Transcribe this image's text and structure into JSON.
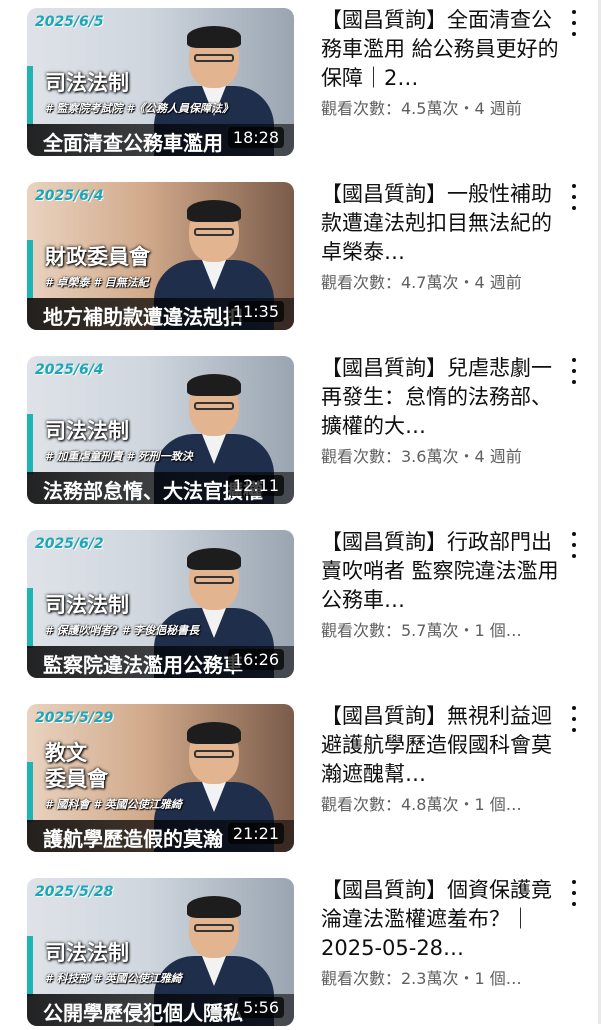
{
  "videos": [
    {
      "date": "2025/6/5",
      "committee": "司法法制",
      "tags": "# 監察院考試院  #《公務人員保障法》",
      "headline": "全面清查公務車濫用",
      "duration": "18:28",
      "title": "【國昌質詢】全面清查公務車濫用 給公務員更好的保障｜2…",
      "meta": "觀看次數：4.5萬次・4 週前"
    },
    {
      "date": "2025/6/4",
      "committee": "財政委員會",
      "tags": "# 卓榮泰  # 目無法紀",
      "headline": "地方補助款遭違法剋扣",
      "duration": "11:35",
      "title": "【國昌質詢】一般性補助款遭違法剋扣目無法紀的卓榮泰…",
      "meta": "觀看次數：4.7萬次・4 週前"
    },
    {
      "date": "2025/6/4",
      "committee": "司法法制",
      "tags": "# 加重虐童刑責  # 死刑一致決",
      "headline": "法務部怠惰、大法官擴權",
      "duration": "12:11",
      "title": "【國昌質詢】兒虐悲劇一再發生：怠惰的法務部、擴權的大…",
      "meta": "觀看次數：3.6萬次・4 週前"
    },
    {
      "date": "2025/6/2",
      "committee": "司法法制",
      "tags": "# 保護吹哨者?  # 李俊俋秘書長",
      "headline": "監察院違法濫用公務車",
      "duration": "16:26",
      "title": "【國昌質詢】行政部門出賣吹哨者 監察院違法濫用公務車…",
      "meta": "觀看次數：5.7萬次・1 個…"
    },
    {
      "date": "2025/5/29",
      "committee": "教文\n委員會",
      "tags": "# 國科會  # 英國公使江雅綺",
      "headline": "護航學歷造假的莫瀚",
      "duration": "21:21",
      "title": "【國昌質詢】無視利益迴避護航學歷造假國科會莫瀚遮醜幫…",
      "meta": "觀看次數：4.8萬次・1 個…"
    },
    {
      "date": "2025/5/28",
      "committee": "司法法制",
      "tags": "# 科技部  # 英國公使江雅綺",
      "headline": "公開學歷侵犯個人隱私",
      "duration": "5:56",
      "title": "【國昌質詢】個資保護竟淪違法濫權遮羞布？｜2025-05-28…",
      "meta": "觀看次數：2.3萬次・1 個…"
    }
  ]
}
